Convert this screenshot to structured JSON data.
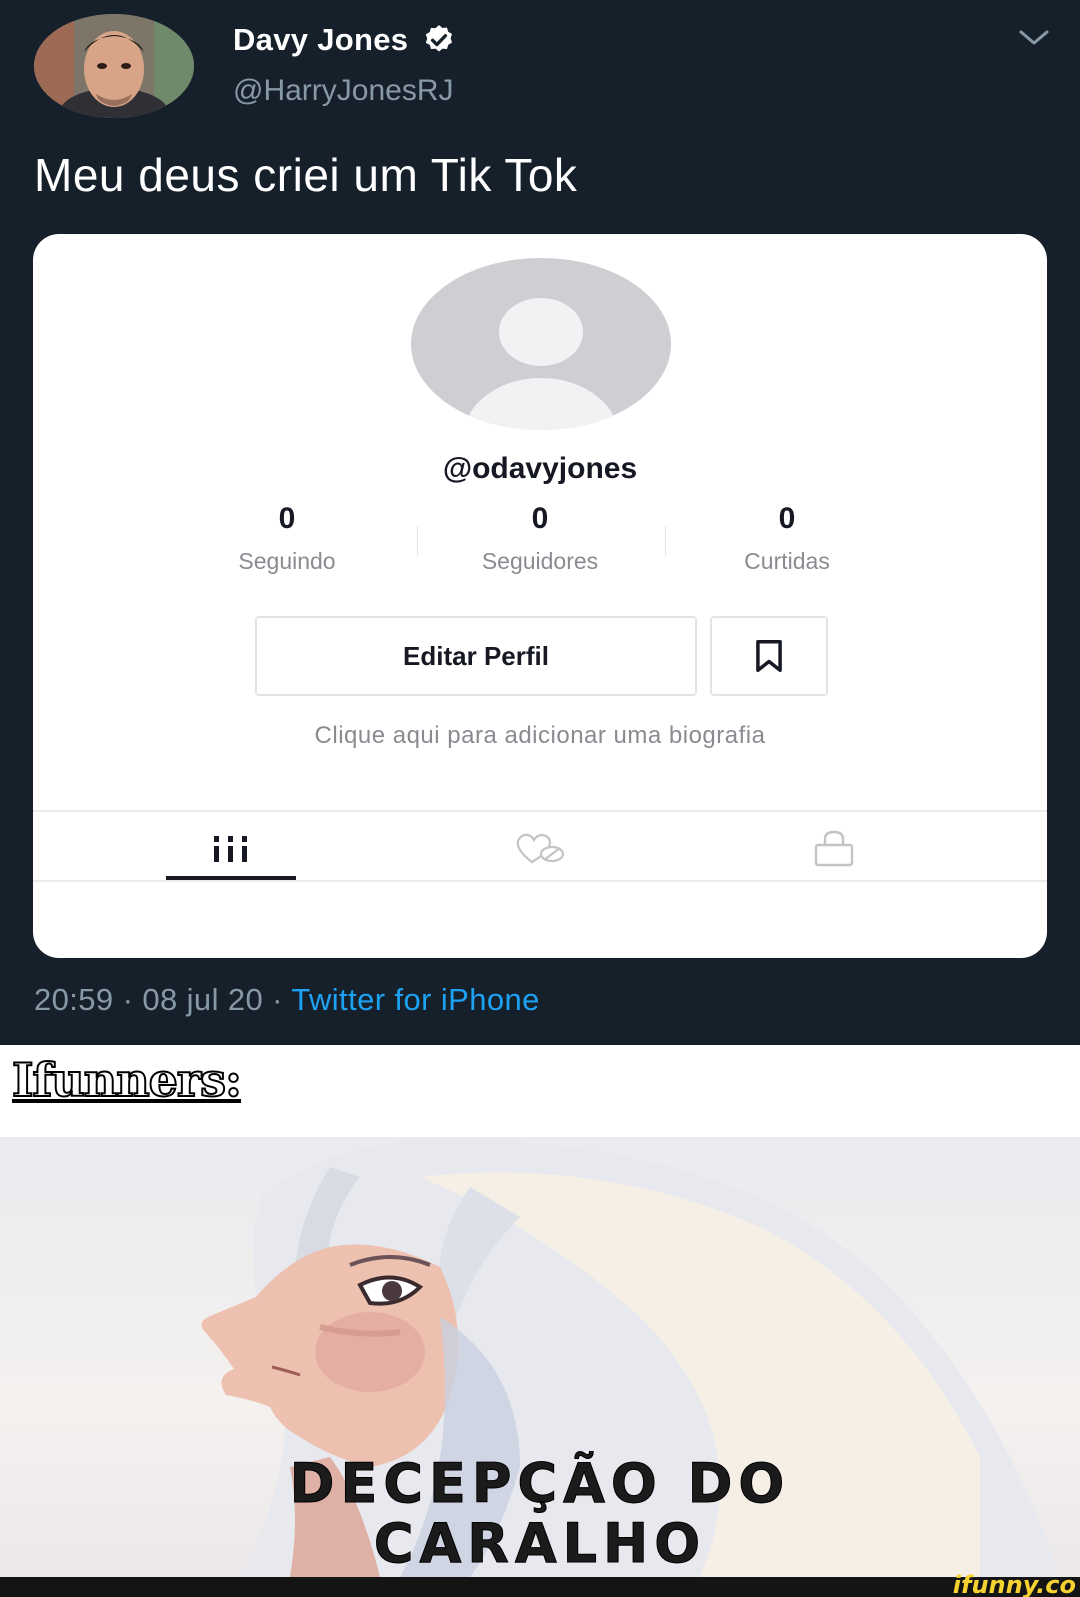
{
  "tweet": {
    "display_name": "Davy Jones",
    "handle": "@HarryJonesRJ",
    "text": "Meu deus criei um Tik Tok",
    "time": "20:59",
    "date": "08 jul 20",
    "separator": "·",
    "source": "Twitter for iPhone"
  },
  "tiktok": {
    "username": "@odavyjones",
    "stats": [
      {
        "value": "0",
        "label": "Seguindo"
      },
      {
        "value": "0",
        "label": "Seguidores"
      },
      {
        "value": "0",
        "label": "Curtidas"
      }
    ],
    "edit_button": "Editar Perfil",
    "bio_placeholder": "Clique aqui para adicionar uma biografia",
    "tabs": [
      {
        "icon": "grid-icon",
        "active": true
      },
      {
        "icon": "liked-heart-icon",
        "active": false
      },
      {
        "icon": "lock-icon",
        "active": false
      }
    ]
  },
  "meme": {
    "caption": "Ifunners:",
    "text_line1": "DECEPÇÃO DO",
    "text_line2": "CARALHO",
    "watermark": "ifunny.co"
  },
  "colors": {
    "twitter_bg": "#15202b",
    "twitter_link": "#1da1f2",
    "muted": "#8899a6",
    "watermark": "#f6d230"
  }
}
